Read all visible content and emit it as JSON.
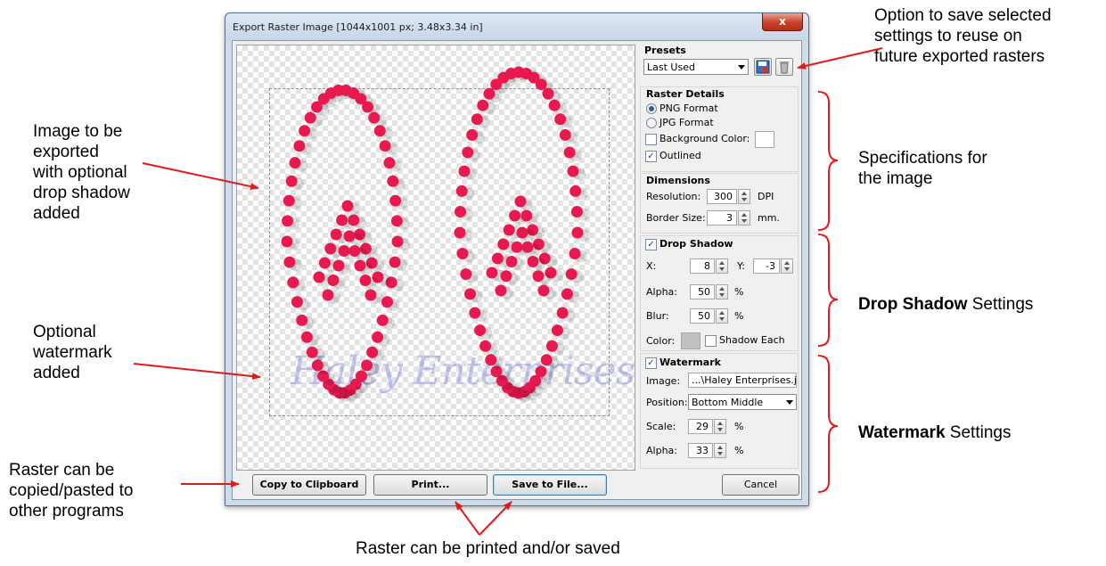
{
  "dialog": {
    "title": "Export Raster Image [1044x1001 px; 3.48x3.34 in]",
    "close_glyph": "x"
  },
  "preview": {
    "watermark_text": "Haley Enterprises"
  },
  "buttons": {
    "copy": "Copy to Clipboard",
    "print": "Print...",
    "save": "Save to File...",
    "cancel": "Cancel"
  },
  "presets": {
    "title": "Presets",
    "selected": "Last Used",
    "save_icon": "save-preset-icon",
    "delete_icon": "delete-preset-icon"
  },
  "raster_details": {
    "title": "Raster Details",
    "png_label": "PNG Format",
    "jpg_label": "JPG Format",
    "png_selected": true,
    "background_label": "Background Color:",
    "background_checked": false,
    "background_color": "#ffffff",
    "outlined_label": "Outlined",
    "outlined_checked": true
  },
  "dimensions": {
    "title": "Dimensions",
    "resolution_label": "Resolution:",
    "resolution_value": "300",
    "resolution_unit": "DPI",
    "border_label": "Border Size:",
    "border_value": "3",
    "border_unit": "mm."
  },
  "drop_shadow": {
    "title": "Drop Shadow",
    "enabled": true,
    "x_label": "X:",
    "x_value": "8",
    "y_label": "Y:",
    "y_value": "-3",
    "alpha_label": "Alpha:",
    "alpha_value": "50",
    "alpha_unit": "%",
    "blur_label": "Blur:",
    "blur_value": "50",
    "blur_unit": "%",
    "color_label": "Color:",
    "color_value": "#c0c0c0",
    "shadow_each_label": "Shadow Each",
    "shadow_each_checked": false
  },
  "watermark": {
    "title": "Watermark",
    "enabled": true,
    "image_label": "Image:",
    "image_value": "...\\Haley Enterprises.jp",
    "position_label": "Position:",
    "position_value": "Bottom Middle",
    "scale_label": "Scale:",
    "scale_value": "29",
    "scale_unit": "%",
    "alpha_label": "Alpha:",
    "alpha_value": "33",
    "alpha_unit": "%"
  },
  "annotations": {
    "presets_note": [
      "Option to save selected",
      "settings to reuse on",
      "future exported rasters"
    ],
    "image_note": [
      "Image to be",
      "exported",
      "with optional",
      "drop shadow",
      "added"
    ],
    "spec_note": [
      "Specifications for",
      "the image"
    ],
    "watermark_note": [
      "Optional",
      "watermark",
      "added"
    ],
    "drop_shadow_bold": "Drop Shadow",
    "drop_shadow_rest": " Settings",
    "watermark_bold": "Watermark",
    "watermark_rest": " Settings",
    "clipboard_note": [
      "Raster can be",
      "copied/pasted to",
      "other programs"
    ],
    "print_note": "Raster can be printed and/or saved"
  },
  "colors": {
    "rhinestone": "#e8194f",
    "arrow": "#e01b1b",
    "bracket": "#e01b1b",
    "watermark_text": "#7d80d7"
  }
}
